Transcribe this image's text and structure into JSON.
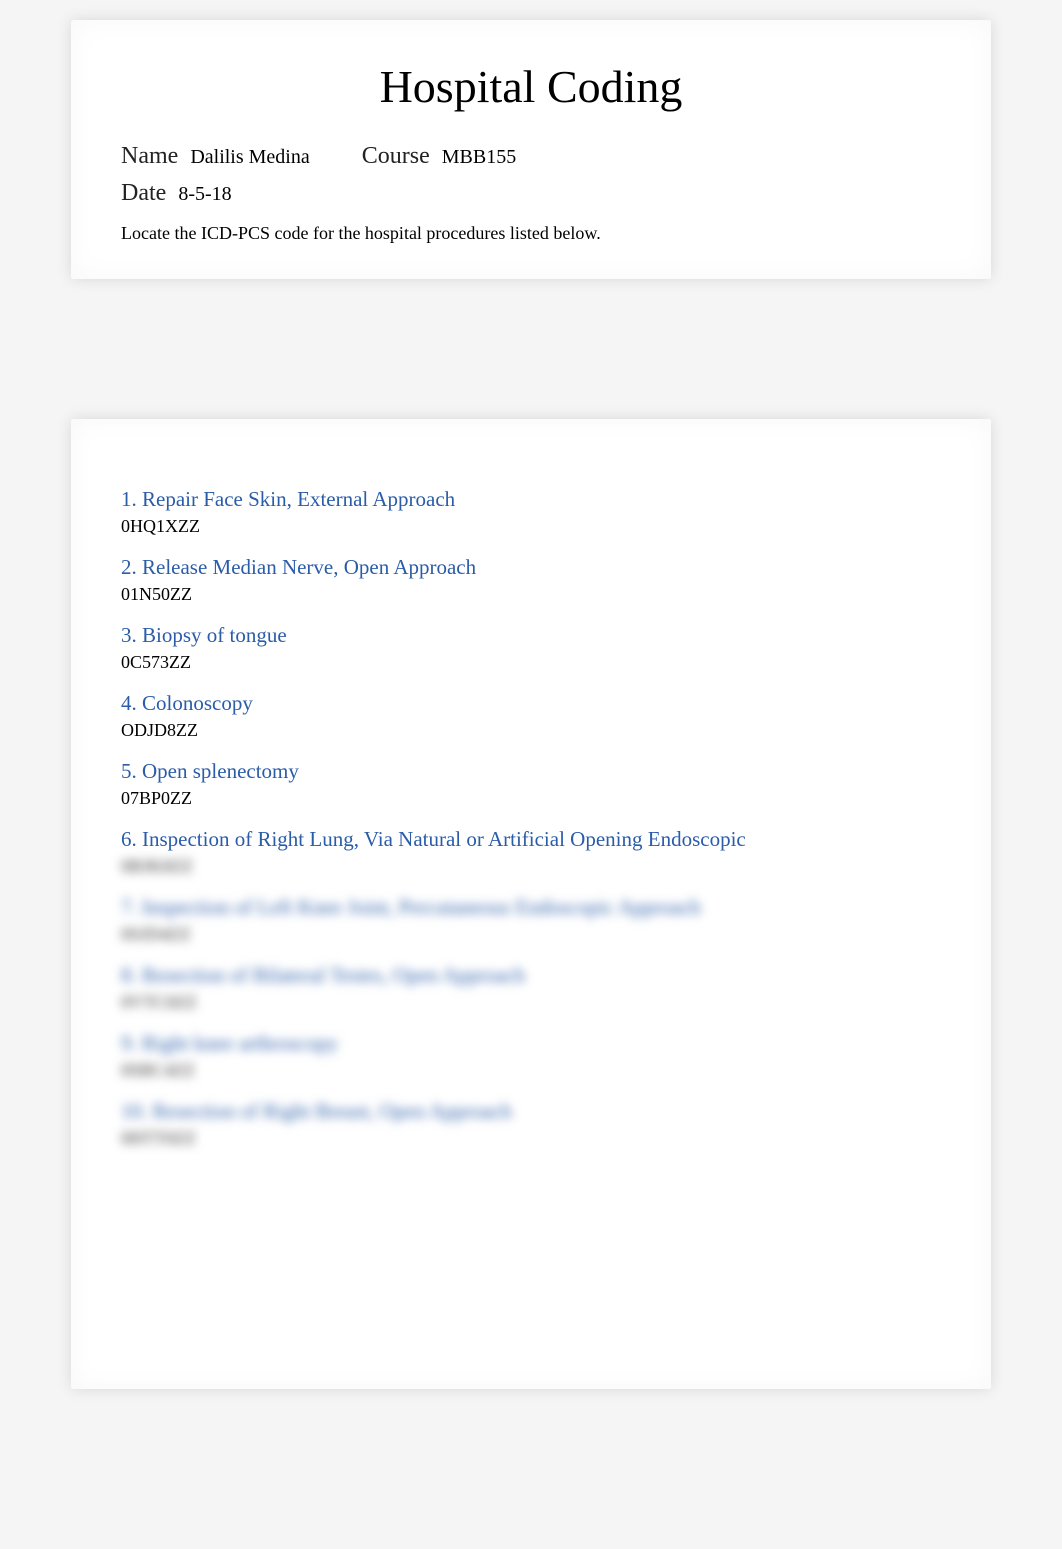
{
  "header": {
    "title": "Hospital Coding",
    "name_label": "Name",
    "name_value": "Dalilis Medina",
    "course_label": "Course",
    "course_value": "MBB155",
    "date_label": "Date",
    "date_value": "8-5-18",
    "instructions": "Locate the ICD-PCS code for the hospital procedures listed below."
  },
  "items": [
    {
      "question": "1. Repair Face Skin, External Approach",
      "answer": "0HQ1XZZ",
      "q_blurred": false,
      "a_blurred": false
    },
    {
      "question": "2. Release Median Nerve, Open Approach",
      "answer": "01N50ZZ",
      "q_blurred": false,
      "a_blurred": false
    },
    {
      "question": "3. Biopsy of tongue",
      "answer": "0C573ZZ",
      "q_blurred": false,
      "a_blurred": false
    },
    {
      "question": "4. Colonoscopy",
      "answer": "ODJD8ZZ",
      "q_blurred": false,
      "a_blurred": false
    },
    {
      "question": "5. Open splenectomy",
      "answer": "07BP0ZZ",
      "q_blurred": false,
      "a_blurred": false
    },
    {
      "question": "6. Inspection of Right Lung, Via Natural or Artificial Opening Endoscopic",
      "answer": "0BJK8ZZ",
      "q_blurred": false,
      "a_blurred": true
    },
    {
      "question": "7. Inspection of Left Knee Joint, Percutaneous Endoscopic Approach",
      "answer": "0SJD4ZZ",
      "q_blurred": true,
      "a_blurred": true
    },
    {
      "question": "8. Resection of Bilateral Testes, Open Approach",
      "answer": "0VTC0ZZ",
      "q_blurred": true,
      "a_blurred": true
    },
    {
      "question": "9. Right knee arthroscopy",
      "answer": "0SBC4ZZ",
      "q_blurred": true,
      "a_blurred": true
    },
    {
      "question": "10. Resection of Right Breast, Open Approach",
      "answer": "0HTT0ZZ",
      "q_blurred": true,
      "a_blurred": true
    }
  ]
}
